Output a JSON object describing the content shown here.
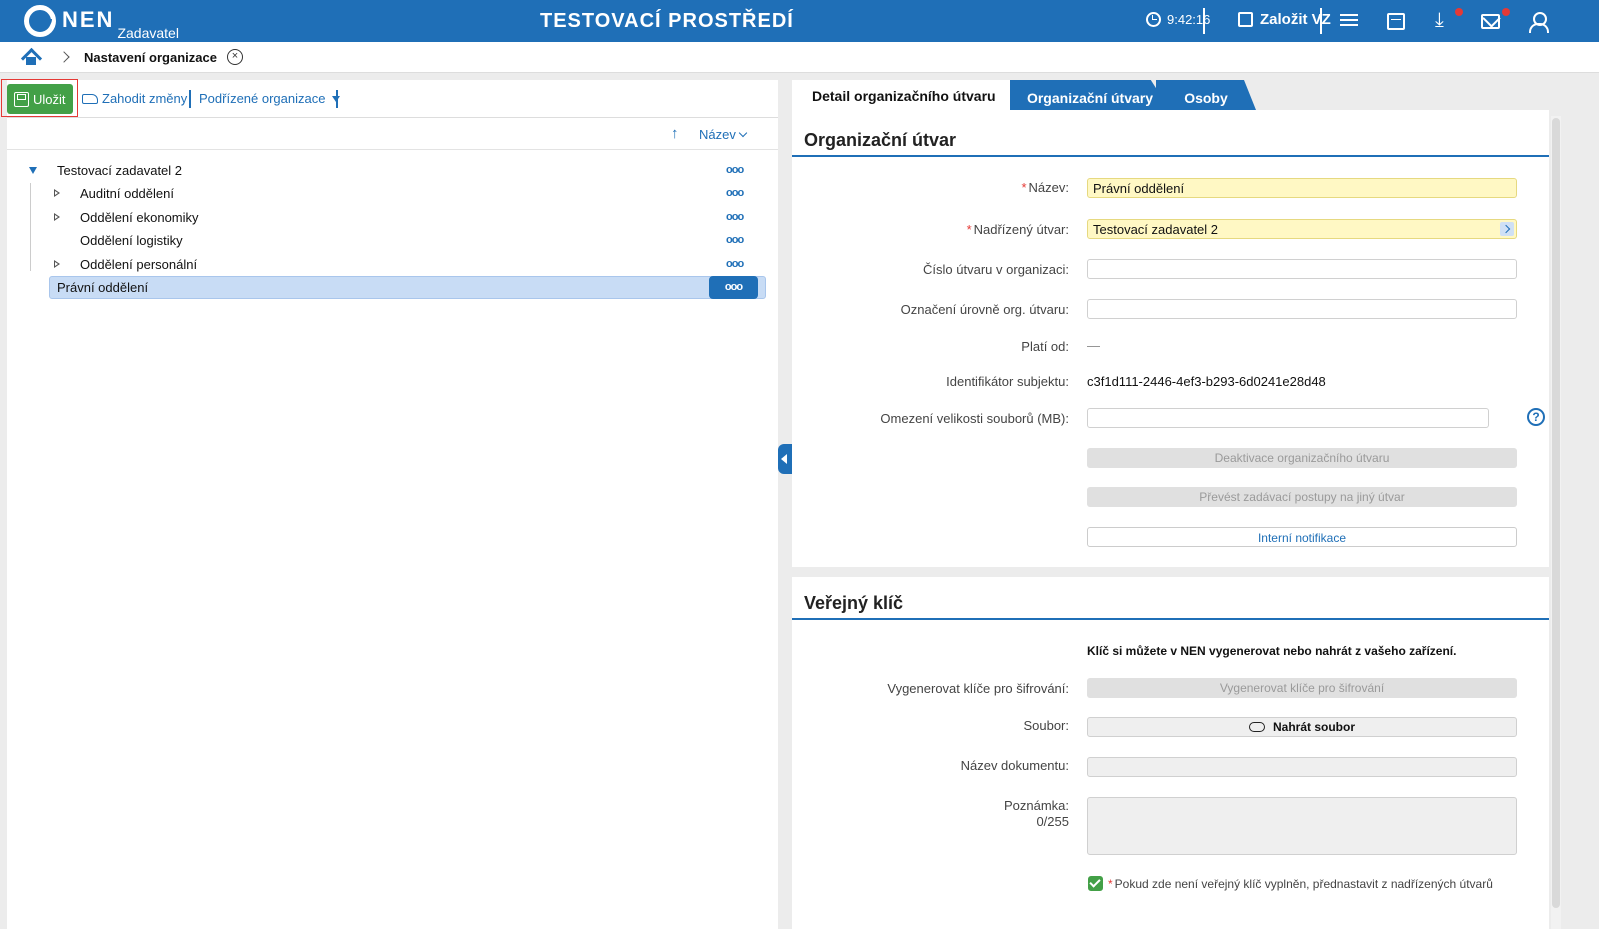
{
  "topbar": {
    "logo_text": "NEN",
    "logo_sub": "Zadavatel",
    "environment": "TESTOVACÍ PROSTŘEDÍ",
    "clock": "9:42:16",
    "create_label": "Založit VZ",
    "accent": "#1f6fb7"
  },
  "breadcrumb": {
    "current": "Nastavení organizace",
    "close_glyph": "×"
  },
  "toolbar": {
    "save_label": "Uložit",
    "discard_label": "Zahodit změny",
    "sub_orgs_label": "Podřízené organizace"
  },
  "sort": {
    "arrow": "↑",
    "label": "Název"
  },
  "tree": {
    "dots": "ooo",
    "root": "Testovací zadavatel 2",
    "children": [
      {
        "label": "Auditní oddělení",
        "expandable": true
      },
      {
        "label": "Oddělení ekonomiky",
        "expandable": true
      },
      {
        "label": "Oddělení logistiky",
        "expandable": false
      },
      {
        "label": "Oddělení personální",
        "expandable": true
      }
    ],
    "selected": "Právní oddělení"
  },
  "tabs": {
    "active": "Detail organizačního útvaru",
    "items": [
      "Organizační útvary",
      "Osoby"
    ]
  },
  "org_unit": {
    "title": "Organizační útvar",
    "req_mark": "*",
    "name_label": "Název:",
    "name_value": "Právní oddělení",
    "parent_label": "Nadřízený útvar:",
    "parent_value": "Testovací zadavatel 2",
    "number_label": "Číslo útvaru v organizaci:",
    "level_label": "Označení úrovně org. útvaru:",
    "valid_from_label": "Platí od:",
    "valid_from_value": "—",
    "identifier_label": "Identifikátor subjektu:",
    "identifier_value": "c3f1d111-2446-4ef3-b293-6d0241e28d48",
    "file_limit_label": "Omezení velikosti souborů (MB):",
    "help_glyph": "?",
    "deactivate_label": "Deaktivace organizačního útvaru",
    "transfer_label": "Převést zadávací postupy na jiný útvar",
    "notifications_label": "Interní notifikace"
  },
  "public_key": {
    "title": "Veřejný klíč",
    "info": "Klíč si můžete v NEN vygenerovat nebo nahrát z vašeho zařízení.",
    "generate_label": "Vygenerovat klíče pro šifrování:",
    "generate_button": "Vygenerovat klíče pro šifrování",
    "file_label": "Soubor:",
    "upload_button": "Nahrát soubor",
    "docname_label": "Název dokumentu:",
    "note_label": "Poznámka:",
    "note_counter": "0/255",
    "checkbox_label": "Pokud zde není veřejný klíč vyplněn, přednastavit z nadřízených útvarů"
  }
}
